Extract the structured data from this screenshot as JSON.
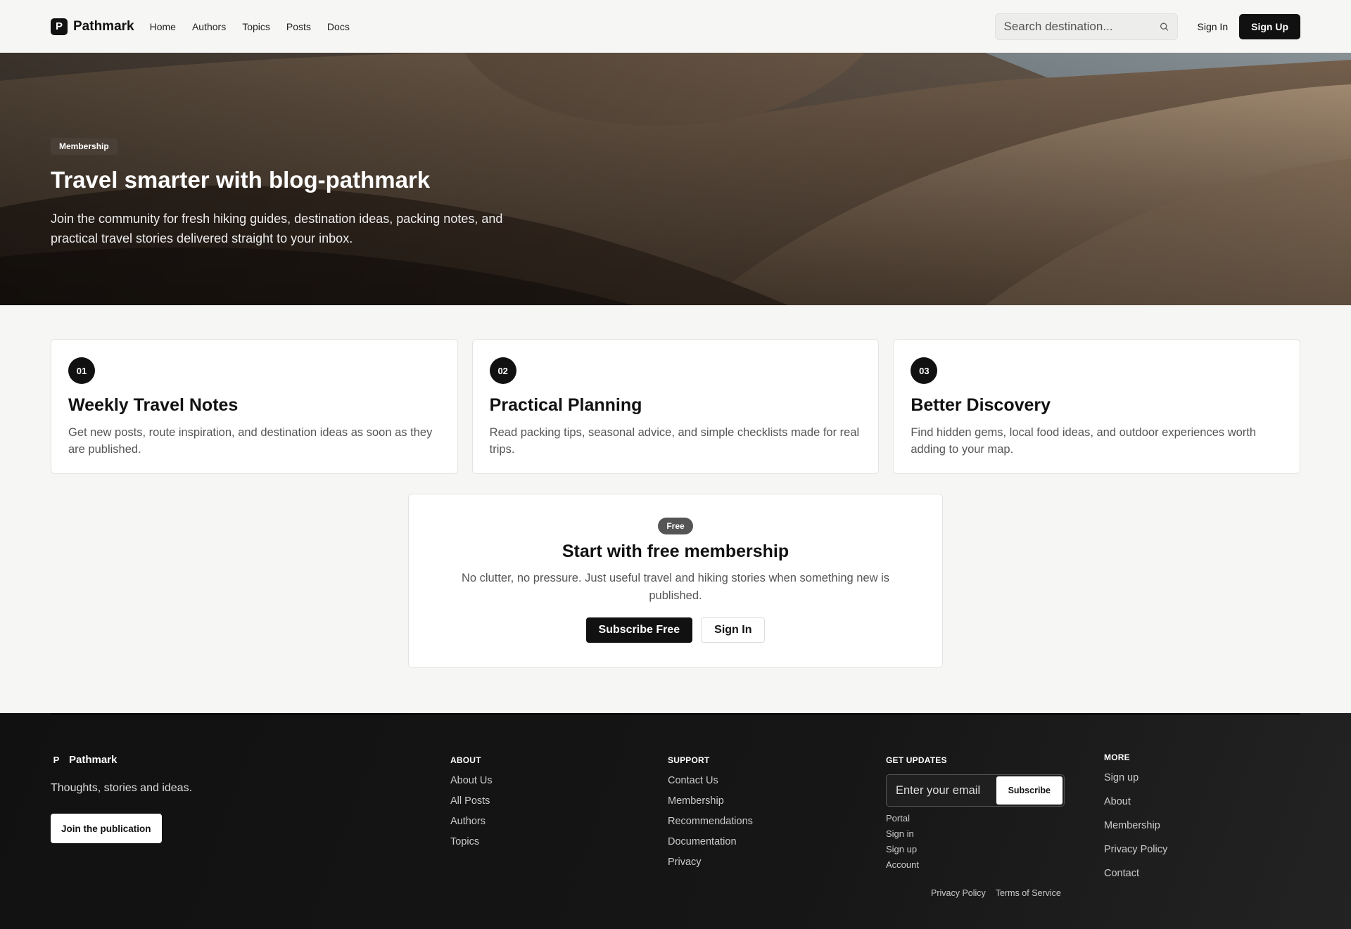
{
  "nav": {
    "brand_mark": "P",
    "brand_name": "Pathmark",
    "links": [
      "Home",
      "Authors",
      "Topics",
      "Posts",
      "Docs"
    ],
    "search_placeholder": "Search destination...",
    "sign_in": "Sign In",
    "sign_up": "Sign Up"
  },
  "hero": {
    "badge": "Membership",
    "title": "Travel smarter with blog-pathmark",
    "subtitle": "Join the community for fresh hiking guides, destination ideas, packing notes, and practical travel stories delivered straight to your inbox."
  },
  "features": [
    {
      "num": "01",
      "title": "Weekly Travel Notes",
      "desc": "Get new posts, route inspiration, and destination ideas as soon as they are published."
    },
    {
      "num": "02",
      "title": "Practical Planning",
      "desc": "Read packing tips, seasonal advice, and simple checklists made for real trips."
    },
    {
      "num": "03",
      "title": "Better Discovery",
      "desc": "Find hidden gems, local food ideas, and outdoor experiences worth adding to your map."
    }
  ],
  "cta": {
    "badge": "Free",
    "title": "Start with free membership",
    "desc": "No clutter, no pressure. Just useful travel and hiking stories when something new is published.",
    "primary": "Subscribe Free",
    "secondary": "Sign In"
  },
  "footer": {
    "brand_mark": "P",
    "brand_name": "Pathmark",
    "tagline": "Thoughts, stories and ideas.",
    "join": "Join the publication",
    "about": {
      "title": "ABOUT",
      "links": [
        "About Us",
        "All Posts",
        "Authors",
        "Topics"
      ]
    },
    "support": {
      "title": "SUPPORT",
      "links": [
        "Contact Us",
        "Membership",
        "Recommendations",
        "Documentation",
        "Privacy"
      ]
    },
    "updates": {
      "title": "GET UPDATES",
      "email_placeholder": "Enter your email",
      "subscribe": "Subscribe",
      "links": [
        "Portal",
        "Sign in",
        "Sign up",
        "Account"
      ]
    },
    "more": {
      "title": "MORE",
      "links": [
        "Sign up",
        "About",
        "Membership",
        "Privacy Policy",
        "Contact"
      ]
    },
    "legal": [
      "Privacy Policy",
      "Terms of Service"
    ]
  },
  "colors": {
    "accent": "#111111",
    "page_bg": "#f6f6f4",
    "footer_bg": "#141414"
  }
}
